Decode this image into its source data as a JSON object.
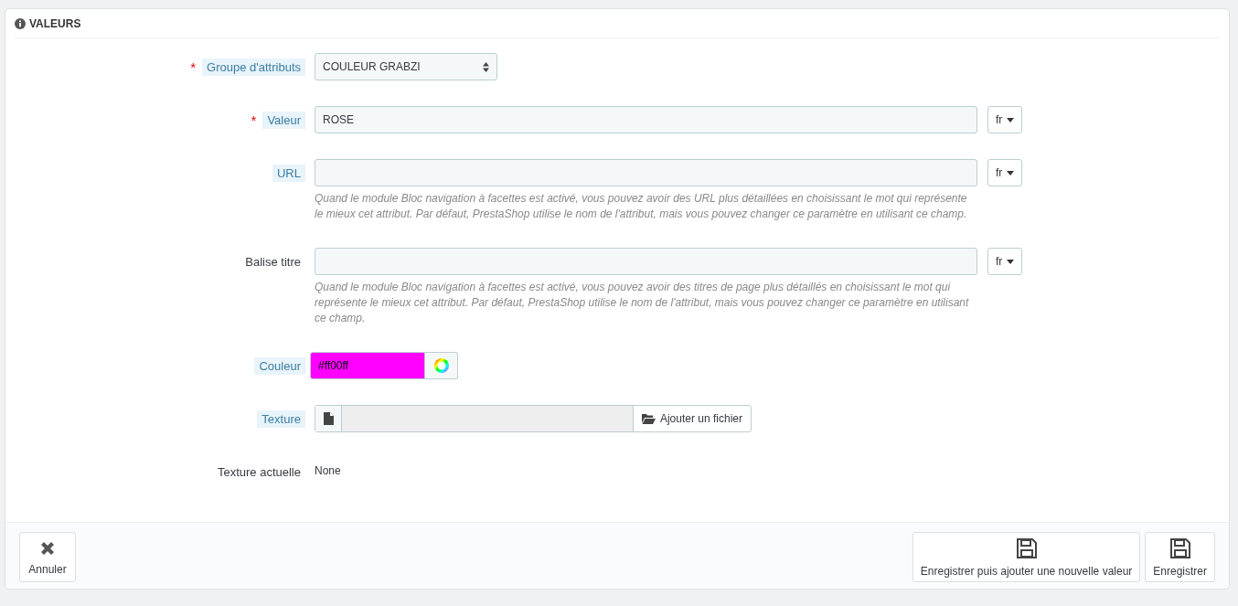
{
  "panel": {
    "title": "VALEURS"
  },
  "fields": [
    {
      "kind": "select",
      "label": "Groupe d'attributs",
      "required_mark": "*",
      "has_help": true,
      "value": "COULEUR GRABZI"
    },
    {
      "kind": "text",
      "label": "Valeur",
      "required_mark": "*",
      "has_help": true,
      "value": "ROSE",
      "language": "fr"
    },
    {
      "kind": "text",
      "label": "URL",
      "has_help": true,
      "language": "fr",
      "help": "Quand le module Bloc navigation à facettes est activé, vous pouvez avoir des URL plus détaillées en choisissant le mot qui représente le mieux cet attribut. Par défaut, PrestaShop utilise le nom de l'attribut, mais vous pouvez changer ce paramètre en utilisant ce champ."
    },
    {
      "kind": "text",
      "label": "Balise titre",
      "has_help": false,
      "language": "fr",
      "help": "Quand le module Bloc navigation à facettes est activé, vous pouvez avoir des titres de page plus détaillés en choisissant le mot qui représente le mieux cet attribut. Par défaut, PrestaShop utilise le nom de l'attribut, mais vous pouvez changer ce paramètre en utilisant ce champ."
    },
    {
      "kind": "color",
      "label": "Couleur",
      "has_help": true,
      "value": "#ff00ff",
      "color": "#ff00ff"
    },
    {
      "kind": "file",
      "label": "Texture",
      "has_help": true,
      "button": "Ajouter un fichier"
    },
    {
      "kind": "static",
      "label": "Texture actuelle",
      "has_help": false,
      "value": "None"
    }
  ],
  "footer": {
    "buttons": [
      {
        "kind": "cancel",
        "label": "Annuler"
      },
      {
        "kind": "save",
        "label": "Enregistrer puis ajouter une nouvelle valeur"
      },
      {
        "kind": "save",
        "label": "Enregistrer"
      }
    ]
  }
}
